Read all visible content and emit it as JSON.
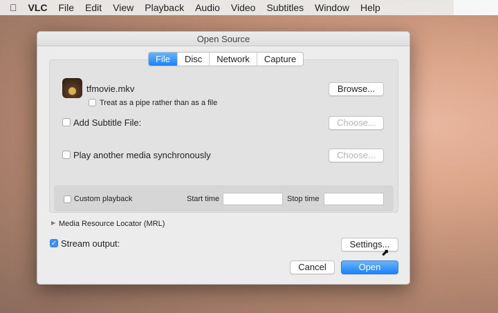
{
  "menubar": {
    "apple": "",
    "items": [
      "VLC",
      "File",
      "Edit",
      "View",
      "Playback",
      "Audio",
      "Video",
      "Subtitles",
      "Window",
      "Help"
    ]
  },
  "dialog": {
    "title": "Open Source",
    "tabs": [
      "File",
      "Disc",
      "Network",
      "Capture"
    ],
    "file_name": "tfmovie.mkv",
    "browse": "Browse...",
    "pipe_label": "Treat as a pipe rather than as a file",
    "subtitle_label": "Add Subtitle File:",
    "choose": "Choose...",
    "sync_label": "Play another media synchronously",
    "custom_playback": "Custom playback",
    "start_time": "Start time",
    "stop_time": "Stop time",
    "mrl": "Media Resource Locator (MRL)",
    "stream_output": "Stream output:",
    "settings": "Settings...",
    "cancel": "Cancel",
    "open": "Open"
  }
}
